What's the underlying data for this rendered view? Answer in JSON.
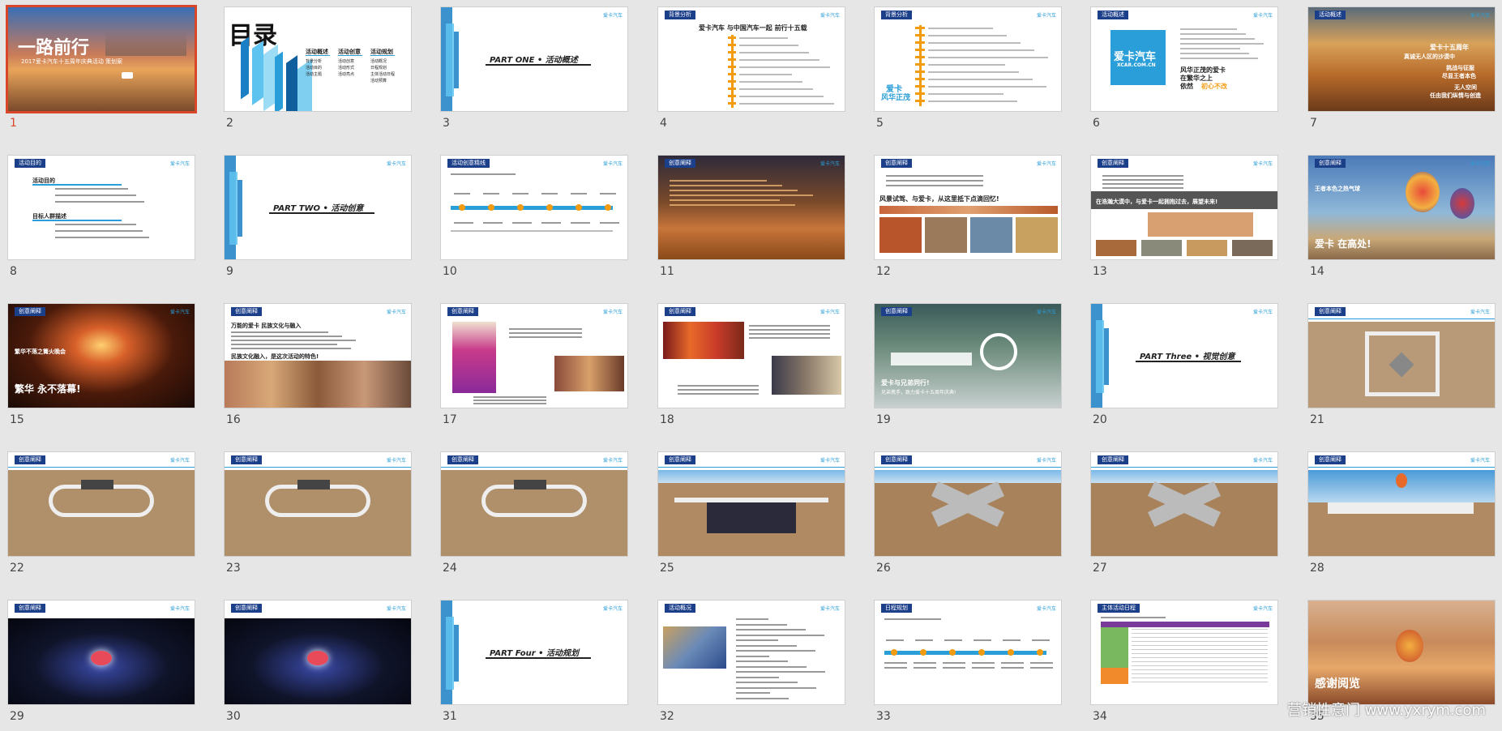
{
  "slides": [
    {
      "num": "1",
      "kind": "cover",
      "title": "一路前行",
      "subtitle": "2017爱卡汽车十五周年庆典活动 策划案"
    },
    {
      "num": "2",
      "kind": "toc",
      "title": "目录",
      "cols": [
        {
          "h": "活动概述",
          "items": [
            "背景分析",
            "活动目的",
            "活动主题"
          ]
        },
        {
          "h": "活动创意",
          "items": [
            "活动创意",
            "活动形式",
            "活动亮点"
          ]
        },
        {
          "h": "活动规划",
          "items": [
            "活动概况",
            "日程规划",
            "主体活动日程",
            "活动预算"
          ]
        }
      ]
    },
    {
      "num": "3",
      "kind": "part",
      "title": "PART ONE • 活动概述"
    },
    {
      "num": "4",
      "kind": "timeline_v",
      "header": "背景分析",
      "title": "爱卡汽车 与中国汽车一起 前行十五载"
    },
    {
      "num": "5",
      "kind": "timeline_v2",
      "header": "背景分析",
      "caption": "爱卡",
      "caption2": "风华正茂"
    },
    {
      "num": "6",
      "kind": "logo",
      "header": "活动概述",
      "logo": "爱卡汽车",
      "logo_sub": "XCAR.COM.CN",
      "l1": "风华正茂的爱卡",
      "l2": "在繁华之上",
      "l3": "依然",
      "l3b": "初心不改"
    },
    {
      "num": "7",
      "kind": "desert",
      "header": "活动概述",
      "l1": "爱卡十五周年",
      "l2": "真诚",
      "l2b": "无人区的沙漠",
      "l2c": "中",
      "l3": "挑战与征服",
      "l4": "尽显",
      "l4b": "王者本色",
      "l5": "无人空间",
      "l6": "任由我们",
      "l6b": "纵情与创造"
    },
    {
      "num": "8",
      "kind": "purpose",
      "header": "活动目的",
      "h1": "活动目的",
      "h2": "目标人群描述"
    },
    {
      "num": "9",
      "kind": "part",
      "title": "PART TWO • 活动创意"
    },
    {
      "num": "10",
      "kind": "timeline_h",
      "header": "活动创意精线",
      "labels": [
        "沙漠风景",
        "沙漠穿越",
        "起动仪式",
        "篝火晚会",
        "欢庆之夜"
      ]
    },
    {
      "num": "11",
      "kind": "desertdark",
      "header": "创意阐释"
    },
    {
      "num": "12",
      "kind": "photos",
      "header": "创意阐释",
      "slogan": "风景试驾、与爱卡，从这里抵下点滴回忆!"
    },
    {
      "num": "13",
      "kind": "grayband",
      "header": "创意阐释",
      "slogan": "在浩瀚大漠中，与爱卡一起拥抱过去，展望未来!"
    },
    {
      "num": "14",
      "kind": "balloon",
      "header": "创意阐释",
      "sub": "王者本色之热气球",
      "slogan": "爱卡 在高处!"
    },
    {
      "num": "15",
      "kind": "fire",
      "header": "创意阐释",
      "sub": "繁华不落之篝火晚会",
      "slogan": "繁华 永不落幕!"
    },
    {
      "num": "16",
      "kind": "culture",
      "header": "创意阐释",
      "title": "万能的爱卡 民族文化与融入",
      "slogan": "民族文化融入，是这次活动的特色!"
    },
    {
      "num": "17",
      "kind": "dance",
      "header": "创意阐释"
    },
    {
      "num": "18",
      "kind": "dance2",
      "header": "创意阐释"
    },
    {
      "num": "19",
      "kind": "benz",
      "header": "创意阐释",
      "slogan": "爱卡与兄弟同行!",
      "sub": "兄弟携手，致力爱卡十五周年庆典!"
    },
    {
      "num": "20",
      "kind": "part",
      "title": "PART Three • 视觉创意"
    },
    {
      "num": "21",
      "kind": "scene",
      "header": "创意阐释",
      "variant": "top"
    },
    {
      "num": "22",
      "kind": "scene",
      "header": "创意阐释",
      "variant": "ring"
    },
    {
      "num": "23",
      "kind": "scene",
      "header": "创意阐释",
      "variant": "ring"
    },
    {
      "num": "24",
      "kind": "scene",
      "header": "创意阐释",
      "variant": "ring"
    },
    {
      "num": "25",
      "kind": "scene",
      "header": "创意阐释",
      "variant": "stage"
    },
    {
      "num": "26",
      "kind": "scene",
      "header": "创意阐释",
      "variant": "track"
    },
    {
      "num": "27",
      "kind": "scene",
      "header": "创意阐释",
      "variant": "track"
    },
    {
      "num": "28",
      "kind": "scene",
      "header": "创意阐释",
      "variant": "balloon"
    },
    {
      "num": "29",
      "kind": "night",
      "header": "创意阐释"
    },
    {
      "num": "30",
      "kind": "night",
      "header": "创意阐释"
    },
    {
      "num": "31",
      "kind": "part",
      "title": "PART Four • 活动规划"
    },
    {
      "num": "32",
      "kind": "overview",
      "header": "活动概况"
    },
    {
      "num": "33",
      "kind": "schedule",
      "header": "日程规划"
    },
    {
      "num": "34",
      "kind": "table",
      "header": "主体活动日程"
    },
    {
      "num": "35",
      "kind": "end",
      "title": "感谢阅览"
    }
  ],
  "brand": "爱卡汽车",
  "watermark": "营销性意门 www.yxrym.com",
  "selected": "1",
  "colors": {
    "accent": "#2a9ed8",
    "header": "#1c3f8a",
    "selection": "#d9472b",
    "orange": "#f39c12"
  }
}
